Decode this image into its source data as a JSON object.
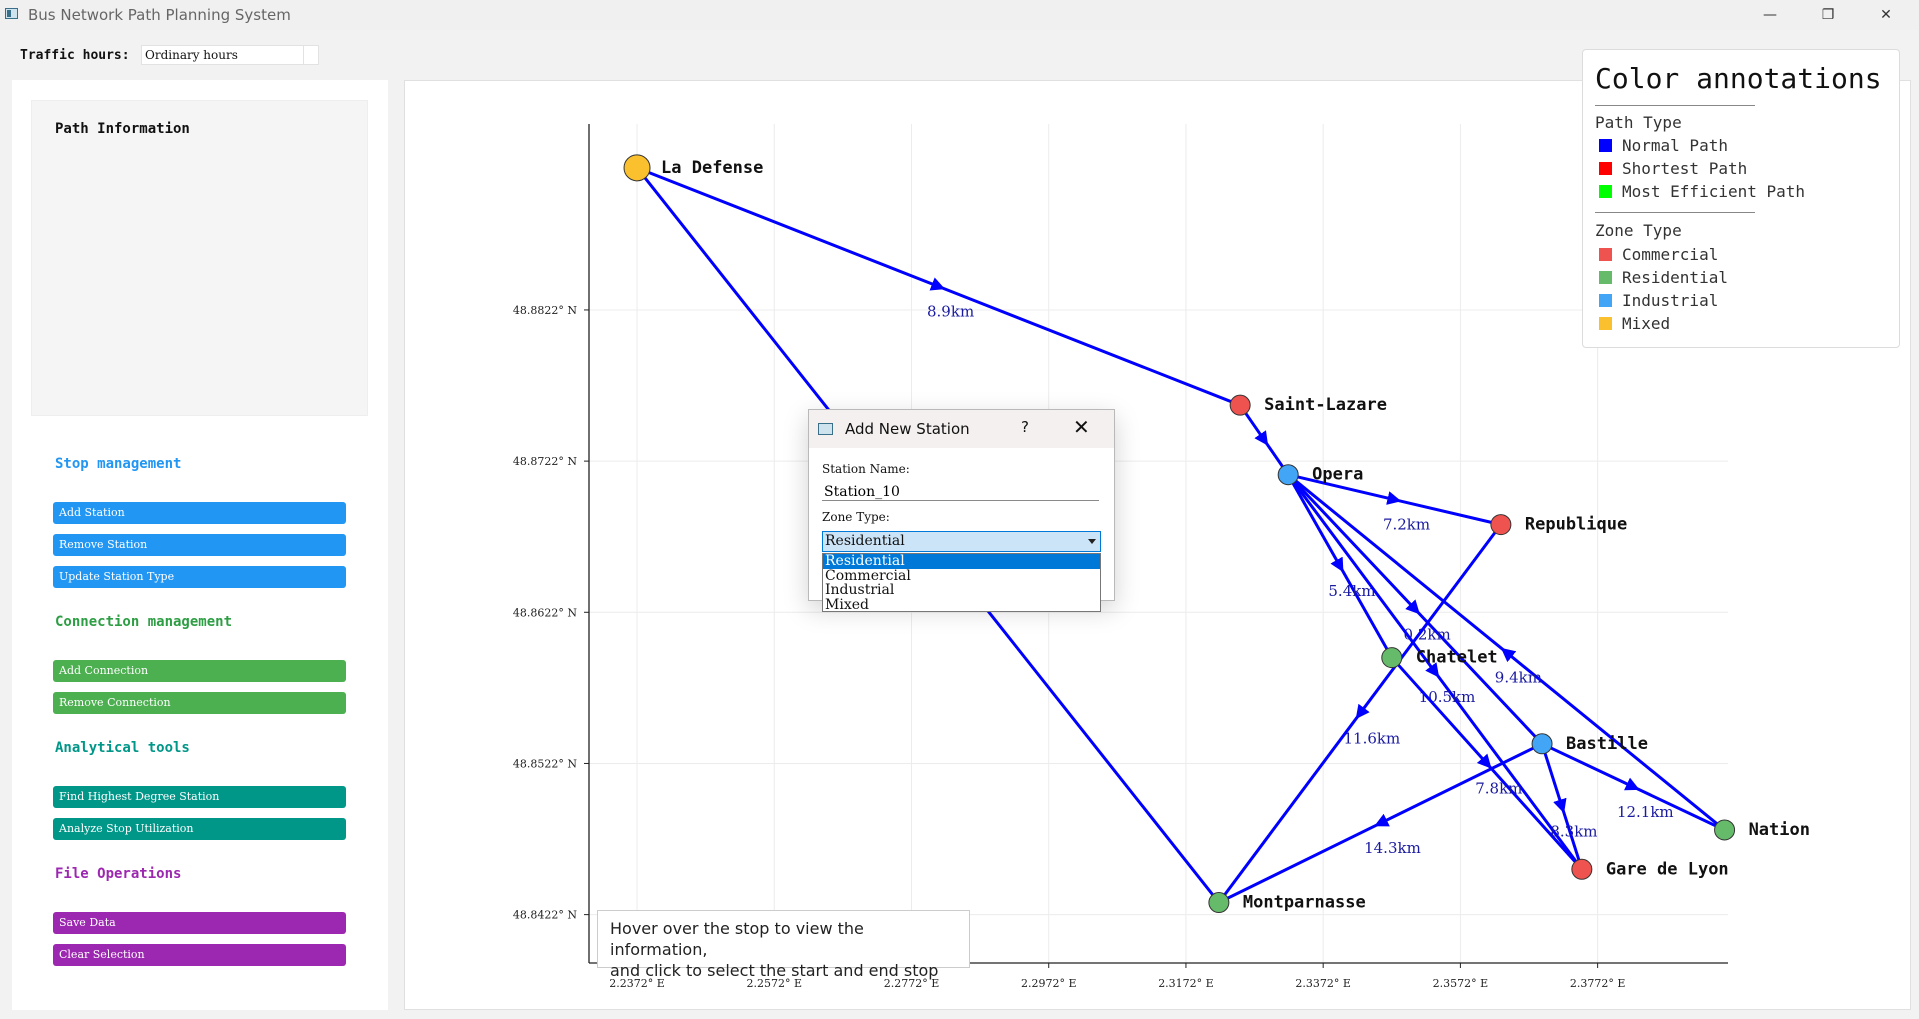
{
  "window": {
    "title": "Bus Network Path Planning System",
    "minimize": "—",
    "maximize": "❐",
    "close": "✕"
  },
  "traffic": {
    "label": "Traffic hours:",
    "value": "Ordinary hours"
  },
  "path_info": {
    "title": "Path Information"
  },
  "stop_management": {
    "title": "Stop management",
    "add": "Add Station",
    "remove": "Remove Station",
    "update": "Update Station Type"
  },
  "connection_management": {
    "title": "Connection management",
    "add": "Add Connection",
    "remove": "Remove Connection"
  },
  "analytical_tools": {
    "title": "Analytical tools",
    "highest": "Find Highest Degree Station",
    "utilization": "Analyze Stop Utilization"
  },
  "file_operations": {
    "title": "File Operations",
    "save": "Save Data",
    "clear": "Clear Selection"
  },
  "legend": {
    "title": "Color annotations",
    "path_type_title": "Path Type",
    "path_types": [
      {
        "label": "Normal Path",
        "color": "#0000ff"
      },
      {
        "label": "Shortest Path",
        "color": "#ff0000"
      },
      {
        "label": "Most Efficient Path",
        "color": "#00ff00"
      }
    ],
    "zone_type_title": "Zone Type",
    "zone_types": [
      {
        "label": "Commercial",
        "color": "#ef5350"
      },
      {
        "label": "Residential",
        "color": "#66bb6a"
      },
      {
        "label": "Industrial",
        "color": "#42a5f5"
      },
      {
        "label": "Mixed",
        "color": "#fbc02d"
      }
    ]
  },
  "hover_tip": {
    "line1": "Hover over the stop to view the information,",
    "line2": "and click to select the start and end stop"
  },
  "dialog": {
    "title": "Add New Station",
    "help": "?",
    "close": "✕",
    "name_label": "Station Name:",
    "name_value": "Station_10",
    "zone_label": "Zone Type:",
    "zone_value": "Residential",
    "zone_options": [
      "Residential",
      "Commercial",
      "Industrial",
      "Mixed"
    ]
  },
  "chart_data": {
    "type": "scatter",
    "x_ticks": [
      "2.2372° E",
      "2.2572° E",
      "2.2772° E",
      "2.2972° E",
      "2.3172° E",
      "2.3372° E",
      "2.3572° E",
      "2.3772° E"
    ],
    "x_tick_values": [
      2.2372,
      2.2572,
      2.2772,
      2.2972,
      2.3172,
      2.3372,
      2.3572,
      2.3772
    ],
    "y_ticks": [
      "48.8822° N",
      "48.8722° N",
      "48.8622° N",
      "48.8522° N",
      "48.8422° N"
    ],
    "y_tick_values": [
      48.8822,
      48.8722,
      48.8622,
      48.8522,
      48.8422
    ],
    "xlim": [
      2.2302,
      2.3962
    ],
    "ylim": [
      48.839,
      48.8945
    ],
    "grid": true,
    "stations": [
      {
        "name": "La Defense",
        "x": 2.2372,
        "y": 48.8916,
        "zone": "Mixed"
      },
      {
        "name": "Saint-Lazare",
        "x": 2.3251,
        "y": 48.8759,
        "zone": "Commercial"
      },
      {
        "name": "Opera",
        "x": 2.3321,
        "y": 48.8713,
        "zone": "Industrial"
      },
      {
        "name": "Republique",
        "x": 2.3631,
        "y": 48.868,
        "zone": "Commercial"
      },
      {
        "name": "Chatelet",
        "x": 2.3472,
        "y": 48.8592,
        "zone": "Residential"
      },
      {
        "name": "Bastille",
        "x": 2.3691,
        "y": 48.8535,
        "zone": "Industrial"
      },
      {
        "name": "Nation",
        "x": 2.3957,
        "y": 48.8478,
        "zone": "Residential"
      },
      {
        "name": "Gare de Lyon",
        "x": 2.3749,
        "y": 48.8452,
        "zone": "Commercial"
      },
      {
        "name": "Montparnasse",
        "x": 2.322,
        "y": 48.843,
        "zone": "Residential"
      }
    ],
    "edges": [
      {
        "from": "La Defense",
        "to": "Saint-Lazare",
        "label": "8.9km"
      },
      {
        "from": "La Defense",
        "to": "Montparnasse",
        "label": ""
      },
      {
        "from": "Saint-Lazare",
        "to": "Opera",
        "label": ""
      },
      {
        "from": "Opera",
        "to": "Republique",
        "label": "7.2km"
      },
      {
        "from": "Opera",
        "to": "Chatelet",
        "label": "5.4km"
      },
      {
        "from": "Opera",
        "to": "Bastille",
        "label": "0.2km"
      },
      {
        "from": "Opera",
        "to": "Gare de Lyon",
        "label": "10.5km"
      },
      {
        "from": "Nation",
        "to": "Opera",
        "label": "9.4km"
      },
      {
        "from": "Republique",
        "to": "Montparnasse",
        "label": "11.6km"
      },
      {
        "from": "Chatelet",
        "to": "Gare de Lyon",
        "label": "7.8km"
      },
      {
        "from": "Bastille",
        "to": "Nation",
        "label": "12.1km"
      },
      {
        "from": "Bastille",
        "to": "Gare de Lyon",
        "label": "8.3km"
      },
      {
        "from": "Bastille",
        "to": "Montparnasse",
        "label": "14.3km"
      }
    ]
  }
}
